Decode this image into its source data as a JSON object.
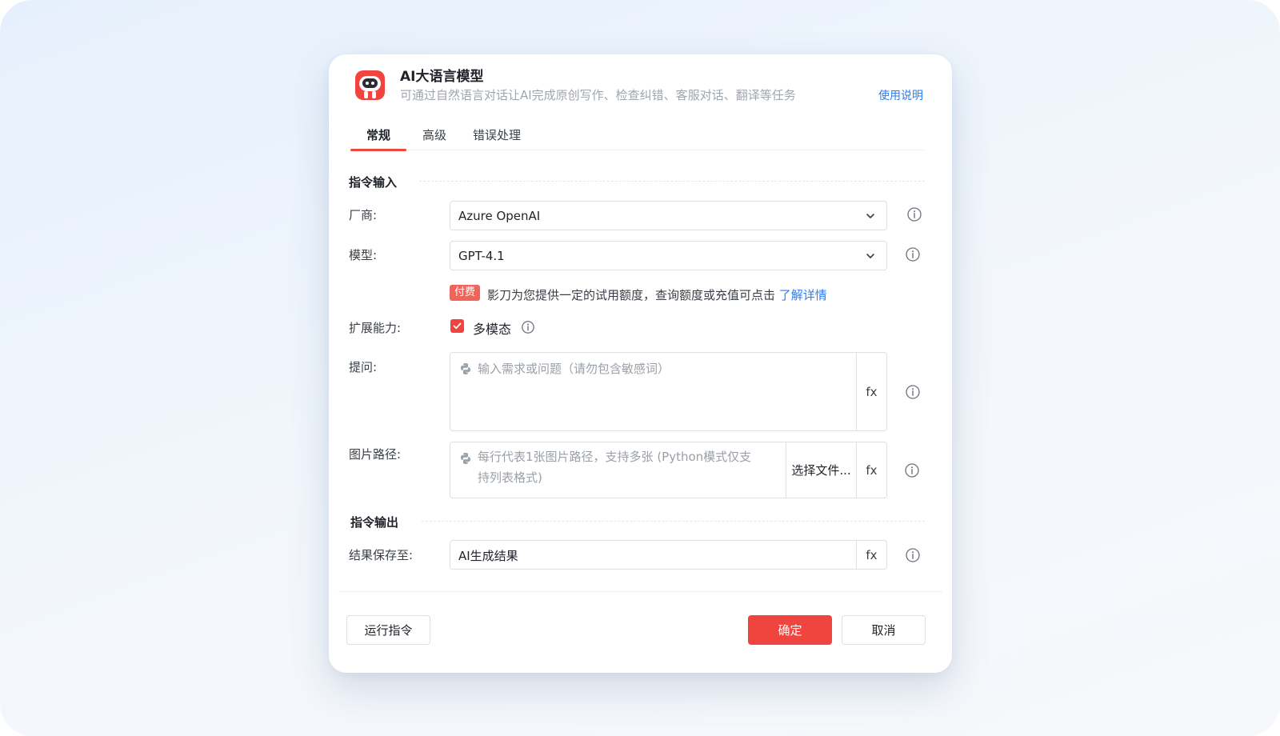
{
  "dialog": {
    "title": "AI大语言模型",
    "subtitle": "可通过自然语言对话让AI完成原创写作、检查纠错、客服对话、翻译等任务",
    "help_link": "使用说明",
    "tabs": [
      {
        "label": "常规",
        "active": true
      },
      {
        "label": "高级",
        "active": false
      },
      {
        "label": "错误处理",
        "active": false
      }
    ]
  },
  "input_section": {
    "title": "指令输入",
    "vendor": {
      "label": "厂商:",
      "value": "Azure OpenAI"
    },
    "model": {
      "label": "模型:",
      "value": "GPT-4.1"
    },
    "paid_notice": {
      "badge": "付费",
      "text": "影刀为您提供一定的试用额度，查询额度或充值可点击",
      "link": "了解详情"
    },
    "extension": {
      "label": "扩展能力:",
      "checkbox_label": "多模态",
      "checked": true
    },
    "prompt": {
      "label": "提问:",
      "placeholder": "输入需求或问题（请勿包含敏感词）",
      "fx": "fx"
    },
    "image_path": {
      "label": "图片路径:",
      "placeholder_line1": "每行代表1张图片路径，支持多张 (Python模式仅支",
      "placeholder_line2": "持列表格式)",
      "file_button": "选择文件...",
      "fx": "fx"
    }
  },
  "output_section": {
    "title": "指令输出",
    "result": {
      "label": "结果保存至:",
      "value": "AI生成结果",
      "fx": "fx"
    }
  },
  "footer": {
    "run_button": "运行指令",
    "confirm_button": "确定",
    "cancel_button": "取消"
  },
  "colors": {
    "accent": "#f0453e",
    "link": "#2d7bf0",
    "badge": "#f0655b"
  }
}
